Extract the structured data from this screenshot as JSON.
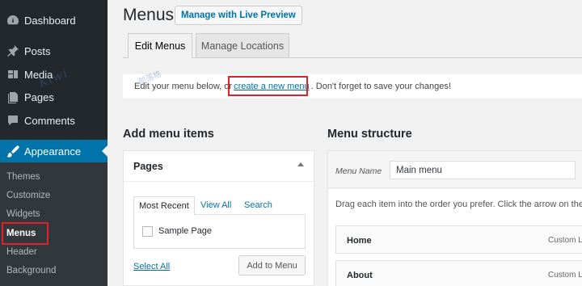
{
  "sidebar": {
    "items": [
      {
        "label": "Dashboard",
        "icon": "dashboard-icon"
      },
      {
        "label": "Posts",
        "icon": "pushpin-icon"
      },
      {
        "label": "Media",
        "icon": "media-icon"
      },
      {
        "label": "Pages",
        "icon": "pages-icon"
      },
      {
        "label": "Comments",
        "icon": "comment-icon"
      },
      {
        "label": "Appearance",
        "icon": "brush-icon"
      }
    ],
    "submenu": [
      "Themes",
      "Customize",
      "Widgets",
      "Menus",
      "Header",
      "Background"
    ]
  },
  "header": {
    "title": "Menus",
    "live_preview_label": "Manage with Live Preview"
  },
  "tabs": [
    "Edit Menus",
    "Manage Locations"
  ],
  "notice": {
    "before": "Edit your menu below, or",
    "link": "create a new menu",
    "after": ". Don't forget to save your changes!"
  },
  "watermark": {
    "text": "Kiwi",
    "subtext": "部落格"
  },
  "add_items": {
    "heading": "Add menu items",
    "box_title": "Pages",
    "tabs": [
      "Most Recent",
      "View All",
      "Search"
    ],
    "page_option": "Sample Page",
    "select_all": "Select All",
    "add_button": "Add to Menu"
  },
  "structure": {
    "heading": "Menu structure",
    "name_label": "Menu Name",
    "name_value": "Main menu",
    "instructions": "Drag each item into the order you prefer. Click the arrow on the",
    "items": [
      {
        "title": "Home",
        "type": "Custom Li"
      },
      {
        "title": "About",
        "type": "Custom Li"
      }
    ]
  },
  "colors": {
    "accent": "#0073aa",
    "sidebar_bg": "#23282d",
    "highlight": "#e0202a"
  }
}
